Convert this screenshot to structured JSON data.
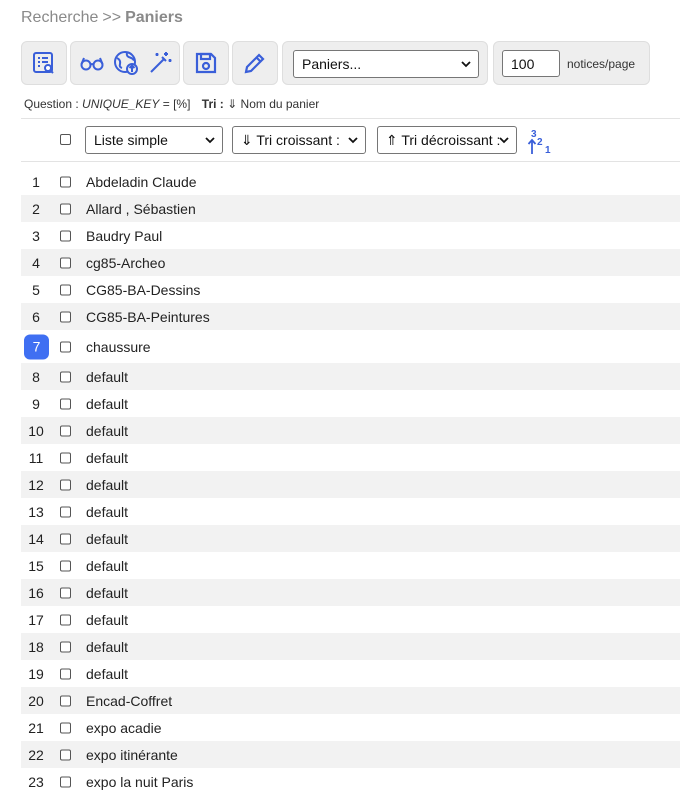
{
  "breadcrumb": {
    "root": "Recherche",
    "separator": ">>",
    "current": "Paniers"
  },
  "toolbar": {
    "basket_select": "Paniers...",
    "per_page_value": "100",
    "per_page_label": "notices/page"
  },
  "question": {
    "label": "Question :",
    "key": "UNIQUE_KEY",
    "value": "= [%]",
    "tri_label": "Tri :",
    "tri_value": "⇓ Nom du panier"
  },
  "controls": {
    "display_select": "Liste simple",
    "sort_asc_select": "⇓ Tri croissant :",
    "sort_desc_select": "⇑ Tri décroissant :"
  },
  "colors": {
    "accent": "#3f6ff2",
    "icon_blue": "#3a5fd9"
  },
  "rows": [
    {
      "index": "1",
      "name": "Abdeladin Claude"
    },
    {
      "index": "2",
      "name": "Allard , Sébastien"
    },
    {
      "index": "3",
      "name": "Baudry Paul"
    },
    {
      "index": "4",
      "name": "cg85-Archeo"
    },
    {
      "index": "5",
      "name": "CG85-BA-Dessins"
    },
    {
      "index": "6",
      "name": "CG85-BA-Peintures"
    },
    {
      "index": "7",
      "name": "chaussure"
    },
    {
      "index": "8",
      "name": "default"
    },
    {
      "index": "9",
      "name": "default"
    },
    {
      "index": "10",
      "name": "default"
    },
    {
      "index": "11",
      "name": "default"
    },
    {
      "index": "12",
      "name": "default"
    },
    {
      "index": "13",
      "name": "default"
    },
    {
      "index": "14",
      "name": "default"
    },
    {
      "index": "15",
      "name": "default"
    },
    {
      "index": "16",
      "name": "default"
    },
    {
      "index": "17",
      "name": "default"
    },
    {
      "index": "18",
      "name": "default"
    },
    {
      "index": "19",
      "name": "default"
    },
    {
      "index": "20",
      "name": "Encad-Coffret"
    },
    {
      "index": "21",
      "name": "expo acadie"
    },
    {
      "index": "22",
      "name": "expo itinérante"
    },
    {
      "index": "23",
      "name": "expo la nuit Paris"
    }
  ]
}
